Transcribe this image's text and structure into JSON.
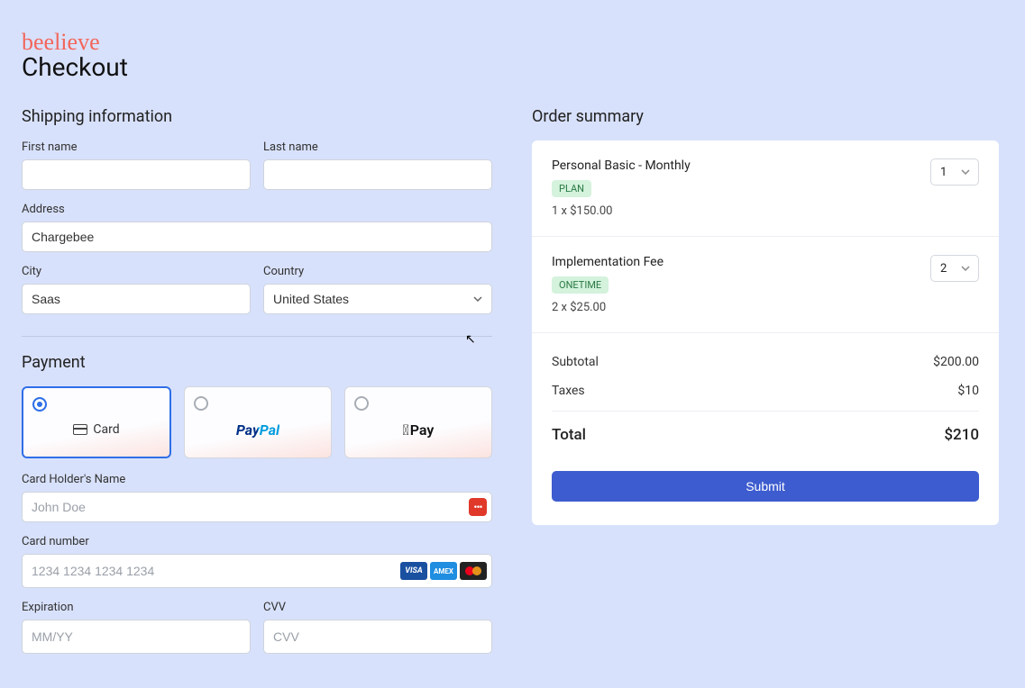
{
  "brand": "beelieve",
  "page_title": "Checkout",
  "shipping": {
    "title": "Shipping information",
    "first_name_label": "First name",
    "first_name_value": "",
    "last_name_label": "Last name",
    "last_name_value": "",
    "address_label": "Address",
    "address_value": "Chargebee",
    "city_label": "City",
    "city_value": "Saas",
    "country_label": "Country",
    "country_value": "United States"
  },
  "payment": {
    "title": "Payment",
    "options": {
      "card": "Card",
      "paypal": "PayPal",
      "applepay": "Pay"
    },
    "selected": "card",
    "holder_label": "Card Holder's Name",
    "holder_placeholder": "John Doe",
    "holder_value": "",
    "number_label": "Card number",
    "number_placeholder": "1234 1234 1234 1234",
    "number_value": "",
    "exp_label": "Expiration",
    "exp_placeholder": "MM/YY",
    "exp_value": "",
    "cvv_label": "CVV",
    "cvv_placeholder": "CVV",
    "cvv_value": "",
    "card_brands": {
      "visa": "VISA",
      "amex": "AMEX"
    }
  },
  "order": {
    "title": "Order summary",
    "items": [
      {
        "name": "Personal Basic - Monthly",
        "badge": "PLAN",
        "qty": "1",
        "line": "1 x $150.00"
      },
      {
        "name": "Implementation Fee",
        "badge": "ONETIME",
        "qty": "2",
        "line": "2 x $25.00"
      }
    ],
    "subtotal_label": "Subtotal",
    "subtotal_value": "$200.00",
    "taxes_label": "Taxes",
    "taxes_value": "$10",
    "total_label": "Total",
    "total_value": "$210",
    "submit_label": "Submit"
  }
}
